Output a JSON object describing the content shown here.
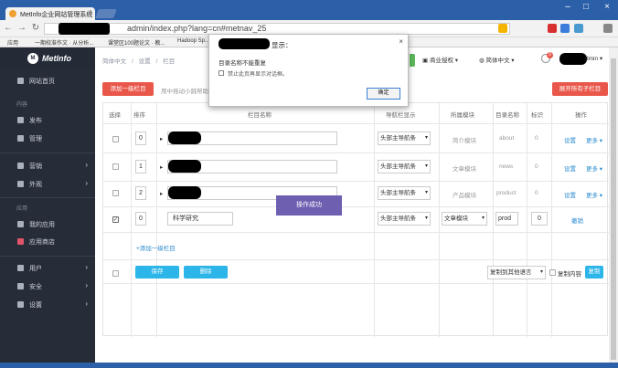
{
  "browser": {
    "tab_title": "MetInfo企业网站管理系统",
    "url_text": "admin/index.php?lang=cn#metnav_25",
    "bookmarks": [
      "应用",
      "一期校准作文 · 从分析...",
      "课堂区100题论文 · 教...",
      "Hadoop Sp..."
    ]
  },
  "sidebar": {
    "brand": "MetInfo",
    "items": [
      {
        "label": "网站首页"
      },
      {
        "label": "发布"
      },
      {
        "label": "管理"
      },
      {
        "label": "营销"
      },
      {
        "label": "外观"
      },
      {
        "label": "我的应用"
      },
      {
        "label": "应用商店"
      },
      {
        "label": "用户"
      },
      {
        "label": "安全"
      },
      {
        "label": "设置"
      }
    ],
    "groups": [
      "内容",
      "应用"
    ]
  },
  "header": {
    "breadcrumb": [
      "简体中文",
      "设置",
      "栏目"
    ],
    "business_auth": "商业授权",
    "language": "简体中文",
    "notif_count": "0",
    "user_suffix": "dmin"
  },
  "toolbar": {
    "add_column": "添加一级栏目",
    "hint": "用中拖动小跳帮助",
    "expand_all": "展开所有子栏目"
  },
  "table": {
    "headers": [
      "选择",
      "排序",
      "栏目名称",
      "导航栏显示",
      "所属模块",
      "目录名称",
      "标识",
      "操作"
    ],
    "rows": [
      {
        "sort": "0",
        "name": "",
        "nav": "头部主导航条",
        "module": "简介模块",
        "dir": "about",
        "mark": "0",
        "op1": "设置",
        "op2": "更多"
      },
      {
        "sort": "1",
        "name": "",
        "nav": "头部主导航条",
        "module": "文章模块",
        "dir": "news",
        "mark": "0",
        "op1": "设置",
        "op2": "更多"
      },
      {
        "sort": "2",
        "name": "",
        "nav": "头部主导航条",
        "module": "产品模块",
        "dir": "product",
        "mark": "0",
        "op1": "设置",
        "op2": "更多"
      },
      {
        "sort": "0",
        "name": "科学研究",
        "nav": "头部主导航条",
        "module": "文章模块",
        "dir": "prod",
        "mark": "0",
        "op1": "撤销",
        "op2": ""
      }
    ],
    "add_link": "+添加一级栏目",
    "save": "保存",
    "delete": "删除",
    "copy_select": "复制到其他语言",
    "copy_content": "复制内容",
    "copy_btn": "复制"
  },
  "toast": "操作成功",
  "dialog": {
    "title": "显示：",
    "message": "目录名称不能重复",
    "checkbox": "禁止此页再显示对话框。",
    "ok": "确定"
  }
}
